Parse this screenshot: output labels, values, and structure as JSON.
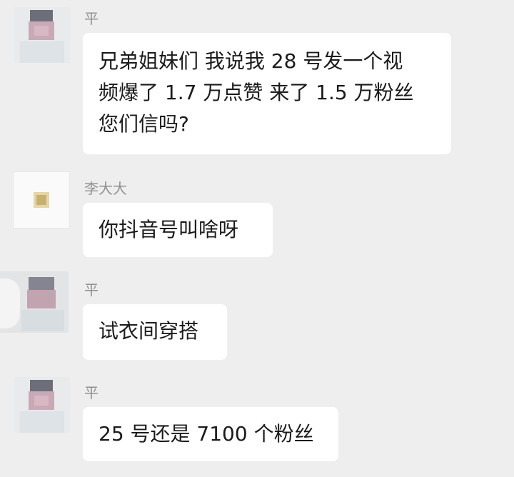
{
  "messages": [
    {
      "sender": "平",
      "lines": [
        "兄弟姐妹们 我说我 28 号发一个视",
        "频爆了 1.7 万点赞  来了 1.5 万粉丝",
        "您们信吗?"
      ],
      "avatar": "person-avatar"
    },
    {
      "sender": "李大大",
      "lines": [
        "你抖音号叫啥呀"
      ],
      "avatar": "logo-avatar"
    },
    {
      "sender": "平",
      "lines": [
        "试衣间穿搭"
      ],
      "avatar": "person-avatar"
    },
    {
      "sender": "平",
      "lines": [
        "25 号还是 7100 个粉丝"
      ],
      "avatar": "person-avatar"
    }
  ],
  "colors": {
    "background": "#eeeeee",
    "bubble": "#ffffff",
    "sender_name": "#8f8f8f",
    "message_text": "#1b1b1b"
  }
}
